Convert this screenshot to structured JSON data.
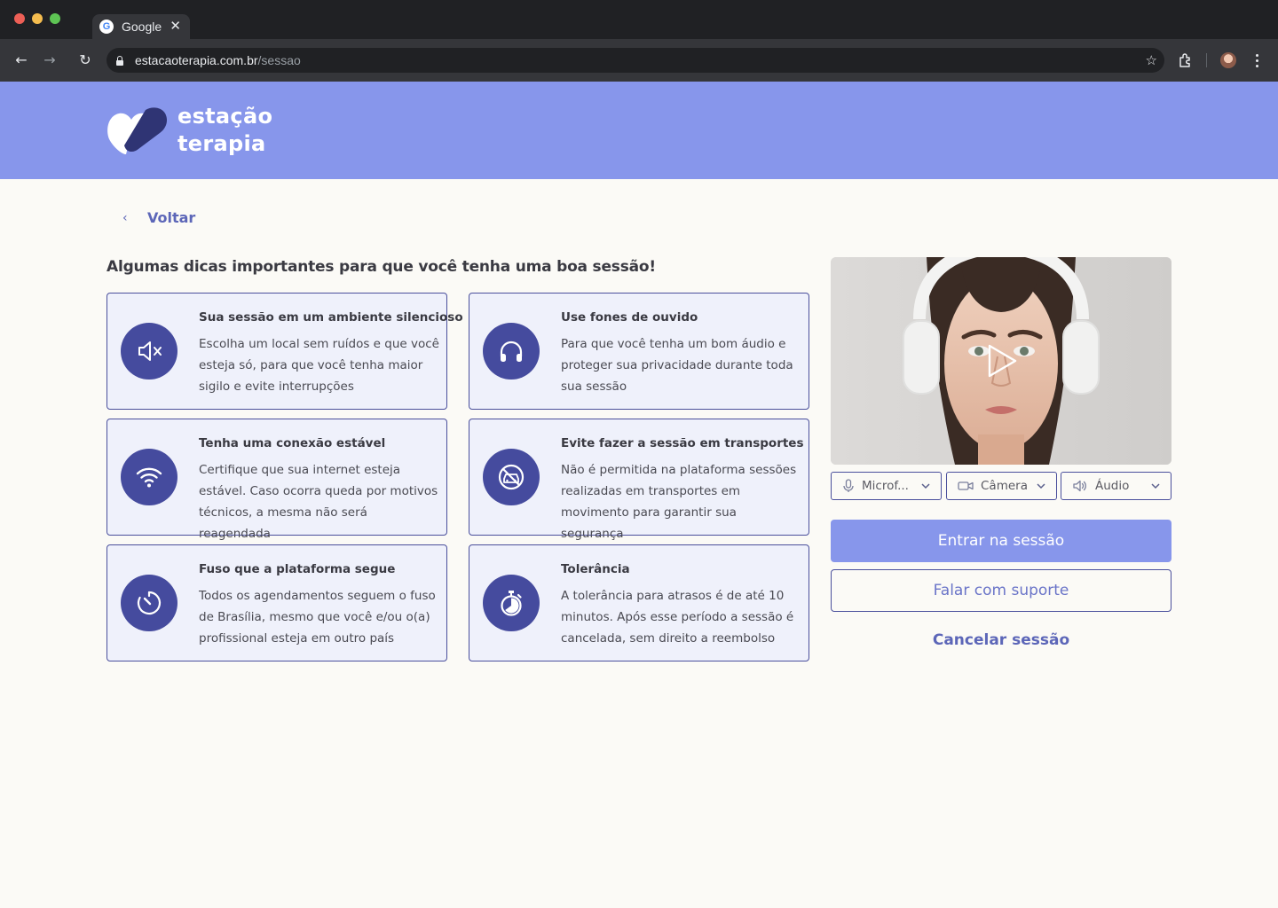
{
  "browser": {
    "tab_title": "Google",
    "tab_favicon": "G",
    "tab_close": "✕",
    "url_host": "estacaoterapia.com.br",
    "url_path": "/sessao",
    "nav_back": "←",
    "nav_forward": "→",
    "nav_reload": "↻",
    "bookmark": "☆"
  },
  "header": {
    "logo_line1": "estação",
    "logo_line2": "terapia"
  },
  "back_label": "Voltar",
  "back_chevron": "‹",
  "main_title": "Algumas dicas importantes para que você tenha uma boa sessão!",
  "tips": [
    {
      "title": "Sua sessão em um ambiente silencioso",
      "description": "Escolha um local sem ruídos e que você esteja só, para que você tenha maior sigilo e evite interrupções",
      "icon": "speaker-muted-icon"
    },
    {
      "title": "Use fones de ouvido",
      "description": "Para que você tenha um bom áudio e proteger sua privacidade durante toda sua sessão",
      "icon": "headphones-icon"
    },
    {
      "title": "Tenha uma conexão estável",
      "description": "Certifique que sua internet esteja estável. Caso ocorra queda por motivos técnicos, a mesma não será reagendada",
      "icon": "wifi-icon"
    },
    {
      "title": "Evite fazer a sessão em transportes",
      "description": "Não é permitida na plataforma sessões realizadas em transportes em movimento para garantir sua segurança",
      "icon": "no-car-icon"
    },
    {
      "title": "Fuso que a plataforma segue",
      "description": "Todos os agendamentos seguem o fuso de Brasília, mesmo que você e/ou o(a) profissional esteja em outro país",
      "icon": "clock-icon"
    },
    {
      "title": "Tolerância",
      "description": "A tolerância para atrasos é de até 10 minutos. Após esse período a sessão é cancelada, sem direito a reembolso",
      "icon": "stopwatch-icon"
    }
  ],
  "devices": {
    "microphone": "Microf...",
    "camera": "Câmera",
    "audio": "Áudio"
  },
  "actions": {
    "enter": "Entrar na sessão",
    "support": "Falar com suporte",
    "cancel": "Cancelar sessão"
  },
  "colors": {
    "brand": "#8796eb",
    "brand_dark": "#454b9e",
    "card_bg": "#eff1fb",
    "link": "#5c66b8"
  }
}
